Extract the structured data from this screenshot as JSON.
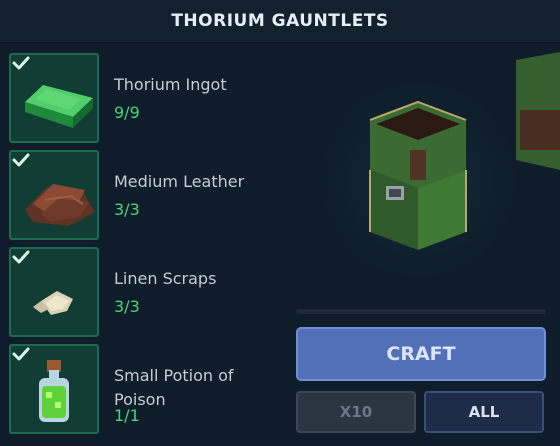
{
  "header": {
    "title": "THORIUM GAUNTLETS"
  },
  "ingredients": [
    {
      "name": "Thorium Ingot",
      "count": "9/9",
      "icon": "thorium-ingot-icon",
      "complete": true
    },
    {
      "name": "Medium Leather",
      "count": "3/3",
      "icon": "medium-leather-icon",
      "complete": true
    },
    {
      "name": "Linen Scraps",
      "count": "3/3",
      "icon": "linen-scraps-icon",
      "complete": true
    },
    {
      "name": "Small Potion of Poison",
      "count": "1/1",
      "icon": "poison-potion-icon",
      "complete": true
    }
  ],
  "preview": {
    "icon": "thorium-gauntlets-model-icon"
  },
  "actions": {
    "craft_label": "CRAFT",
    "x10_label": "X10",
    "all_label": "ALL"
  },
  "colors": {
    "accent": "#5170b8",
    "complete": "#49d47c",
    "slot_border": "#1f6b52"
  }
}
